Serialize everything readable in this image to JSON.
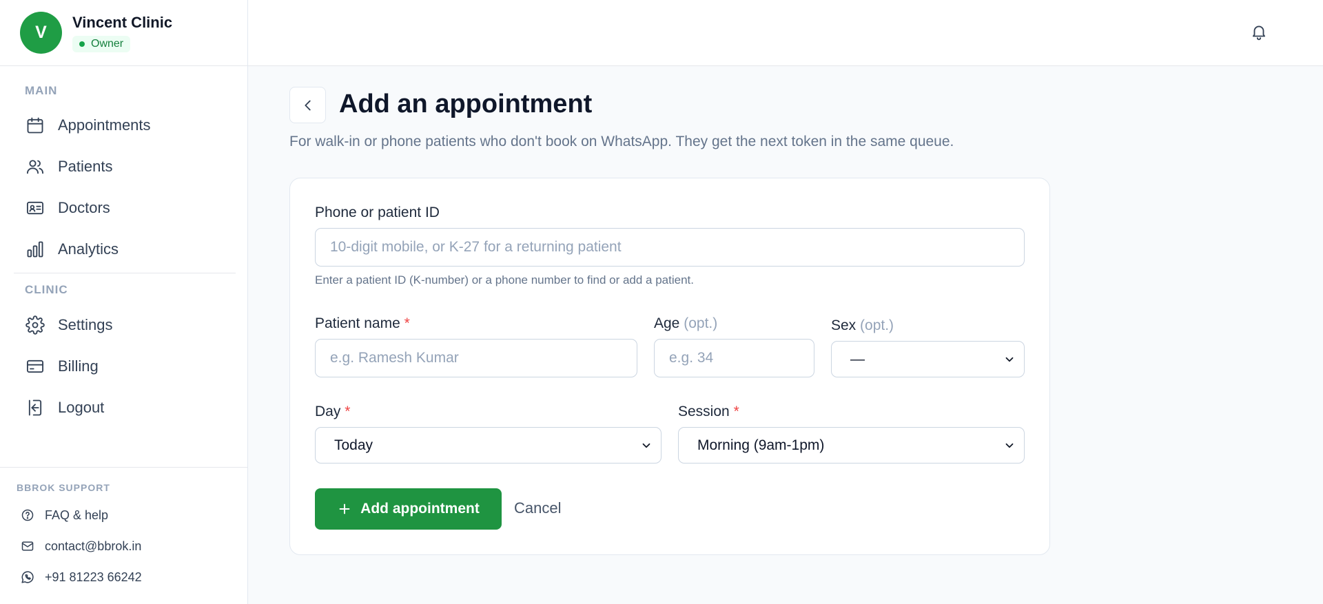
{
  "clinic": {
    "initial": "V",
    "name": "Vincent Clinic",
    "role": "Owner"
  },
  "nav": {
    "main_label": "MAIN",
    "main_items": [
      {
        "label": "Appointments",
        "icon": "calendar-icon"
      },
      {
        "label": "Patients",
        "icon": "users-icon"
      },
      {
        "label": "Doctors",
        "icon": "id-card-icon"
      },
      {
        "label": "Analytics",
        "icon": "bar-chart-icon"
      }
    ],
    "clinic_label": "CLINIC",
    "clinic_items": [
      {
        "label": "Settings",
        "icon": "gear-icon"
      },
      {
        "label": "Billing",
        "icon": "credit-card-icon"
      },
      {
        "label": "Logout",
        "icon": "logout-icon"
      }
    ]
  },
  "support": {
    "label": "BBROK SUPPORT",
    "items": [
      {
        "label": "FAQ & help",
        "icon": "question-circle-icon"
      },
      {
        "label": "contact@bbrok.in",
        "icon": "mail-icon"
      },
      {
        "label": "+91 81223 66242",
        "icon": "whatsapp-icon"
      }
    ]
  },
  "page": {
    "title": "Add an appointment",
    "subtitle": "For walk-in or phone patients who don't book on WhatsApp. They get the next token in the same queue."
  },
  "form": {
    "phone_label": "Phone or patient ID",
    "phone_placeholder": "10-digit mobile, or K-27 for a returning patient",
    "phone_hint": "Enter a patient ID (K-number) or a phone number to find or add a patient.",
    "name_label": "Patient name",
    "name_placeholder": "e.g. Ramesh Kumar",
    "age_label": "Age",
    "age_placeholder": "e.g. 34",
    "sex_label": "Sex",
    "sex_value": "—",
    "opt_text": "(opt.)",
    "required_mark": "*",
    "day_label": "Day",
    "day_value": "Today",
    "session_label": "Session",
    "session_value": "Morning (9am-1pm)",
    "submit_label": "Add appointment",
    "cancel_label": "Cancel"
  },
  "colors": {
    "brand_green": "#1f9441",
    "required_red": "#ef4444",
    "muted": "#94a3b8"
  }
}
